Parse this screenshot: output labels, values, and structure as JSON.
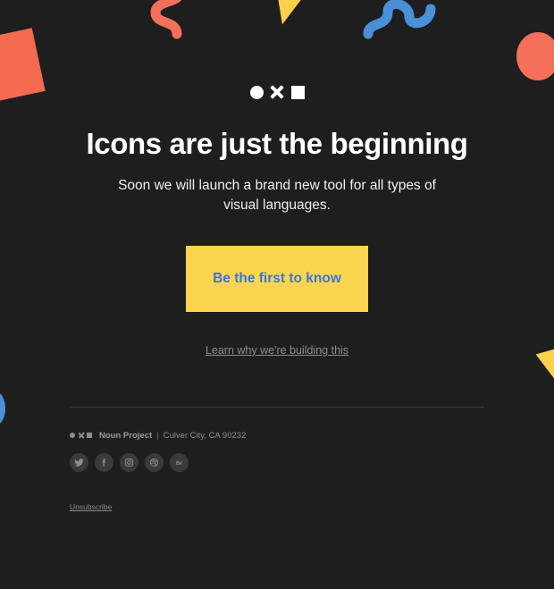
{
  "page": {
    "background_color": "#1e1e1e"
  },
  "brand": {
    "mark_icons": [
      "circle-glyph",
      "x-glyph",
      "square-glyph"
    ]
  },
  "hero": {
    "headline": "Icons are just the beginning",
    "subhead": "Soon we will launch a brand new tool for all types of visual languages.",
    "cta_label": "Be the first to know",
    "cta_background": "#fcd54f",
    "cta_text_color": "#3b72e8",
    "learn_link": "Learn why we're building this"
  },
  "decorations": [
    {
      "name": "orange-square",
      "color": "#f46b4f",
      "shape": "square"
    },
    {
      "name": "orange-squiggle",
      "color": "#f4705a",
      "shape": "squiggle"
    },
    {
      "name": "yellow-triangle-top",
      "color": "#fbd04b",
      "shape": "triangle"
    },
    {
      "name": "blue-squiggle",
      "color": "#4a90d9",
      "shape": "squiggle"
    },
    {
      "name": "orange-circle",
      "color": "#f4705a",
      "shape": "circle"
    },
    {
      "name": "blue-circle",
      "color": "#4a90d9",
      "shape": "circle"
    },
    {
      "name": "yellow-triangle-bottom",
      "color": "#fbd04b",
      "shape": "triangle"
    }
  ],
  "footer": {
    "brand_name": "Noun Project",
    "separator": "|",
    "address": "Culver City, CA 90232",
    "socials": [
      {
        "name": "twitter",
        "label": "Twitter"
      },
      {
        "name": "facebook",
        "label": "Facebook"
      },
      {
        "name": "instagram",
        "label": "Instagram"
      },
      {
        "name": "dribbble",
        "label": "Dribbble"
      },
      {
        "name": "behance",
        "label": "Behance"
      }
    ],
    "unsubscribe": "Unsubscribe"
  }
}
